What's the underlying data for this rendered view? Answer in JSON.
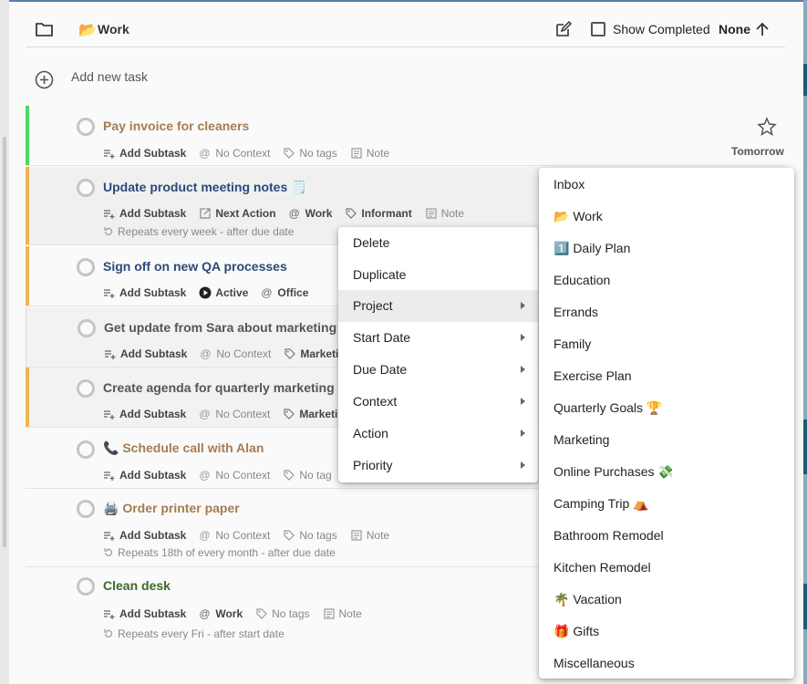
{
  "header": {
    "project_emoji": "📂",
    "project_title": "Work",
    "show_completed_label": "Show Completed",
    "sort_label": "None"
  },
  "add_task": {
    "label": "Add new task"
  },
  "tasks": [
    {
      "title": "Pay invoice for cleaners",
      "title_color": "#a67c52",
      "bar_color": "#4cd964",
      "add_subtask": "Add Subtask",
      "context": "No Context",
      "tags": "No tags",
      "note": "Note",
      "due": "Tomorrow"
    },
    {
      "title": "Update product meeting notes 🗒️",
      "title_color": "#2c4a7a",
      "bar_color": "#f0b454",
      "add_subtask": "Add Subtask",
      "action": "Next Action",
      "context": "Work",
      "tags": "Informant",
      "note": "Note",
      "repeat": "Repeats every week - after due date"
    },
    {
      "title": "Sign off on new QA processes",
      "title_color": "#2c4a7a",
      "bar_color": "#f0b454",
      "add_subtask": "Add Subtask",
      "action": "Active",
      "context": "Office"
    },
    {
      "title": "Get update from Sara about marketing ma",
      "title_color": "#555555",
      "add_subtask": "Add Subtask",
      "context": "No Context",
      "tags": "Marketi"
    },
    {
      "title": "Create agenda for quarterly marketing me",
      "title_color": "#555555",
      "bar_color": "#f0b454",
      "add_subtask": "Add Subtask",
      "context": "No Context",
      "tags": "Marketi"
    },
    {
      "title": "📞 Schedule call with Alan",
      "title_color": "#a67c52",
      "add_subtask": "Add Subtask",
      "context": "No Context",
      "tags": "No tag"
    },
    {
      "title": "🖨️ Order printer paper",
      "title_color": "#a67c52",
      "add_subtask": "Add Subtask",
      "context": "No Context",
      "tags": "No tags",
      "note": "Note",
      "repeat": "Repeats 18th of every month - after due date"
    },
    {
      "title": "Clean desk",
      "title_color": "#3a6b2a",
      "add_subtask": "Add Subtask",
      "context": "Work",
      "tags": "No tags",
      "note": "Note",
      "repeat": "Repeats every Fri - after start date"
    }
  ],
  "context_menu": {
    "items": [
      "Delete",
      "Duplicate",
      "Project",
      "Start Date",
      "Due Date",
      "Context",
      "Action",
      "Priority"
    ]
  },
  "project_menu": {
    "items": [
      "Inbox",
      "📂 Work",
      "1️⃣ Daily Plan",
      "Education",
      "Errands",
      "Family",
      "Exercise Plan",
      "Quarterly Goals 🏆",
      "Marketing",
      "Online Purchases 💸",
      "Camping Trip ⛺",
      "Bathroom Remodel",
      "Kitchen Remodel",
      "🌴 Vacation",
      "🎁 Gifts",
      "Miscellaneous"
    ]
  }
}
